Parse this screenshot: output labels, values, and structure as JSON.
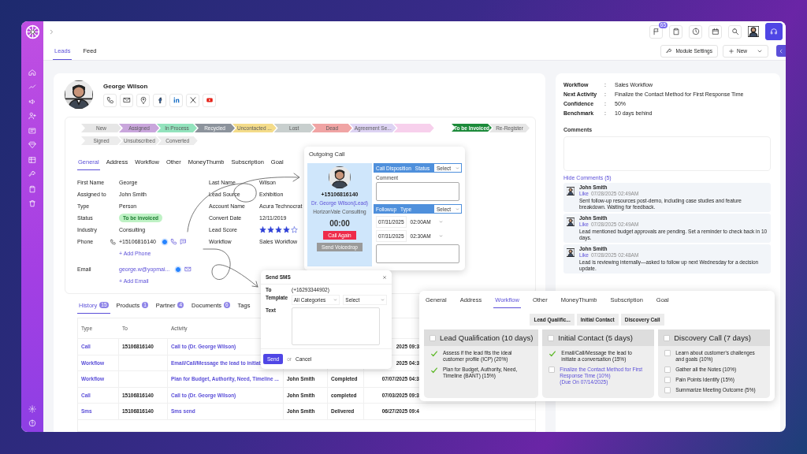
{
  "topbar": {
    "notifications": "65"
  },
  "tabs": [
    {
      "label": "Leads",
      "selected": true
    },
    {
      "label": "Feed",
      "selected": false
    }
  ],
  "toolbar": {
    "module_settings": "Module Settings",
    "new_button": "New"
  },
  "lead": {
    "name": "George Wilson"
  },
  "stage_rows": [
    {
      "stages": [
        {
          "label": "New",
          "color": "#e6e6e6",
          "selected": false
        },
        {
          "label": "Assigned",
          "color": "#c9a6dc",
          "selected": false
        },
        {
          "label": "In Process",
          "color": "#93e3bd",
          "selected": false
        },
        {
          "label": "Recycled",
          "color": "#8c939c",
          "selected": false
        },
        {
          "label": "Uncontacted ...",
          "color": "#f4dc8a",
          "selected": false
        },
        {
          "label": "Lost",
          "color": "#c8cfce",
          "selected": false
        },
        {
          "label": "Dead",
          "color": "#f0a4a4",
          "selected": false
        },
        {
          "label": "Agreement Se...",
          "color": "#ddd3f3",
          "selected": false
        },
        {
          "color": "#f7d0ec",
          "selected": false
        },
        {
          "label": "To be Invoiced",
          "color": "#1c8a3a",
          "selected": true
        },
        {
          "label": "Re-Register",
          "color": "#e6e6e6",
          "selected": false
        }
      ]
    },
    {
      "stages": [
        {
          "label": "Signed",
          "color": "#ececec",
          "selected": false
        },
        {
          "label": "Unsubscribed",
          "color": "#ececec",
          "selected": false
        },
        {
          "label": "Converted",
          "color": "#ececec",
          "selected": false
        }
      ]
    }
  ],
  "detail_tabs": [
    {
      "label": "General",
      "selected": true
    },
    {
      "label": "Address",
      "selected": false
    },
    {
      "label": "Workflow",
      "selected": false
    },
    {
      "label": "Other",
      "selected": false
    },
    {
      "label": "MoneyThumb",
      "selected": false
    },
    {
      "label": "Subscription",
      "selected": false
    },
    {
      "label": "Goal",
      "selected": false
    }
  ],
  "fields_left": [
    {
      "label": "First Name",
      "value": "George",
      "kind": "text"
    },
    {
      "label": "Assigned to",
      "value": "John Smith",
      "kind": "text"
    },
    {
      "label": "Type",
      "value": "Person",
      "kind": "text"
    },
    {
      "label": "Status",
      "value": "To be invoiced",
      "kind": "badge"
    },
    {
      "label": "Industry",
      "value": "Consulting",
      "kind": "text"
    },
    {
      "label": "Phone",
      "value": "+15106816140",
      "kind": "phone",
      "add": "+ Add Phone",
      "primary": true
    },
    {
      "label": "Email",
      "value": "george.w@yopmai...",
      "kind": "email",
      "add": "+ Add Email",
      "primary": true
    }
  ],
  "fields_right": [
    {
      "label": "Last Name",
      "value": "Wilson",
      "kind": "text"
    },
    {
      "label": "Lead Source",
      "value": "Exhibition",
      "kind": "text"
    },
    {
      "label": "Account Name",
      "value": "Acura Technocrat",
      "kind": "text"
    },
    {
      "label": "Convert Date",
      "value": "12/11/2019",
      "kind": "text"
    },
    {
      "label": "Lead Score",
      "stars": 4,
      "kind": "stars"
    },
    {
      "label": "Workflow",
      "value": "Sales Workflow",
      "kind": "text"
    }
  ],
  "history_tabs": [
    {
      "label": "History",
      "count": "15",
      "selected": true
    },
    {
      "label": "Products",
      "count": "1",
      "selected": false
    },
    {
      "label": "Partner",
      "count": "4",
      "selected": false
    },
    {
      "label": "Documents",
      "count": "6",
      "selected": false
    },
    {
      "label": "Tags",
      "selected": false
    }
  ],
  "history_table": {
    "columns": [
      "Type",
      "To",
      "Activity"
    ],
    "rows": [
      {
        "type": "Call",
        "to": "15106816140",
        "activity": "Call to (Dr. George Wilson)",
        "date": "2025 09:3"
      },
      {
        "type": "Workflow",
        "activity": "Email/Call/Message the lead to initiat",
        "date": "2025 04:3"
      },
      {
        "type": "Workflow",
        "activity": "Plan for Budget, Authority, Need, Timeline ...",
        "owner": "John Smith",
        "status": "Completed",
        "date": "07/07/2025 04:3"
      },
      {
        "type": "Call",
        "to": "15106816140",
        "activity": "Call to (Dr. George Wilson)",
        "owner": "John Smith",
        "status": "completed",
        "date": "07/03/2025 09:3"
      },
      {
        "type": "Sms",
        "to": "15106816140",
        "activity": "Sms send",
        "owner": "John Smith",
        "status": "Delivered",
        "date": "06/27/2025 09:4"
      }
    ]
  },
  "summary": [
    {
      "label": "Workflow",
      "separator": ":",
      "value": "Sales Workflow"
    },
    {
      "label": "Next Activity",
      "separator": ":",
      "value": "Finalize the Contact Method for First Response Time"
    },
    {
      "label": "Confidence",
      "separator": ":",
      "value": "50%"
    },
    {
      "label": "Benchmark",
      "separator": ":",
      "value": "10 days behind"
    }
  ],
  "comments": {
    "label": "Comments",
    "toggle": "Hide Comments (5)",
    "items": [
      {
        "author": "John Smith",
        "like": "Like",
        "time": "07/28/2025 02:49AM",
        "text": "Sent follow-up resources post-demo, including case studies and feature breakdown. Waiting for feedback."
      },
      {
        "author": "John Smith",
        "like": "Like",
        "time": "07/28/2025 02:49AM",
        "text": "Lead mentioned budget approvals are pending. Set a reminder to check back in 10 days."
      },
      {
        "author": "John Smith",
        "like": "Like",
        "time": "07/28/2025 02:48AM",
        "text": "Lead is reviewing internally—asked to follow up next Wednesday for a decision update."
      }
    ]
  },
  "call": {
    "title": "Outgoing Call",
    "phone": "+15106816140",
    "name": "Dr. George Wilson(Lead)",
    "company": "HorizonVale Consulting",
    "timer": "00:00",
    "call_again": "Call Again",
    "voicedrop": "Send Voicedrop",
    "disposition": "Call Disposition",
    "status": "Status",
    "status_select": "Select",
    "comment": "Comment",
    "followup": "Followup",
    "type": "Type",
    "type_select": "Select",
    "slots": [
      {
        "date": "07/31/2025",
        "time": "02:00AM"
      },
      {
        "date": "07/31/2025",
        "time": "02:30AM"
      }
    ]
  },
  "sms": {
    "title": "Send SMS",
    "to_label": "To",
    "to": "(+16293344902)",
    "template_label": "Template",
    "category": "All Categories",
    "template": "Select",
    "text_label": "Text",
    "send": "Send",
    "or": "or",
    "cancel": "Cancel"
  },
  "workflow": {
    "tabs": [
      {
        "label": "General",
        "selected": false
      },
      {
        "label": "Address",
        "selected": false
      },
      {
        "label": "Workflow",
        "selected": true
      },
      {
        "label": "Other",
        "selected": false
      },
      {
        "label": "MoneyThumb",
        "selected": false
      },
      {
        "label": "Subscription",
        "selected": false
      },
      {
        "label": "Goal",
        "selected": false
      }
    ],
    "stage_buttons": [
      "Lead Qualific...",
      "Initial Contact",
      "Discovery Call"
    ],
    "columns": [
      {
        "title": "Lead Qualification (10 days)",
        "checked": false,
        "tasks": [
          {
            "text": "Assess if the lead fits the ideal customer profile (ICP) (20%)",
            "checked": true
          },
          {
            "text": "Plan for Budget, Authority, Need, Timeline (BANT) (15%)",
            "checked": true
          }
        ]
      },
      {
        "title": "Initial Contact (5 days)",
        "checked": false,
        "tasks": [
          {
            "text": "Email/Call/Message the lead to initiate a conversation (15%)",
            "checked": true
          },
          {
            "text": "Finalize the Contact Method for First Response Time (10%)",
            "due": "(Due On 07/14/2025)",
            "checked": false
          }
        ]
      },
      {
        "title": "Discovery Call (7 days)",
        "checked": false,
        "tasks": [
          {
            "text": "Learn about customer's challenges and goals (10%)",
            "checked": false
          },
          {
            "text": "Gather all the Notes (10%)",
            "checked": false
          },
          {
            "text": "Pain Points Identify (15%)",
            "checked": false
          },
          {
            "text": "Summarize Meeting Outcome (5%)",
            "checked": false
          }
        ]
      }
    ]
  }
}
